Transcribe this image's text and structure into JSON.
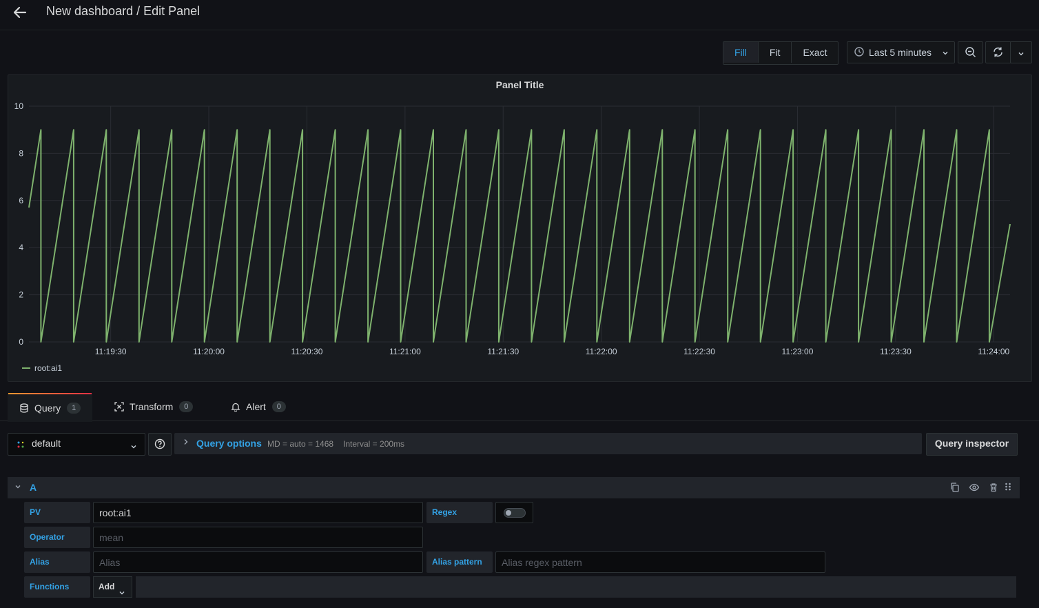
{
  "header": {
    "title": "New dashboard / Edit Panel"
  },
  "view_modes": {
    "fill": "Fill",
    "fit": "Fit",
    "exact": "Exact",
    "selected": "Fill"
  },
  "time_picker": {
    "label": "Last 5 minutes"
  },
  "panel": {
    "title": "Panel Title",
    "legend": "root:ai1"
  },
  "chart_data": {
    "type": "line",
    "title": "Panel Title",
    "xlabel": "",
    "ylabel": "",
    "ylim": [
      0,
      10
    ],
    "y_ticks": [
      "0",
      "2",
      "4",
      "6",
      "8",
      "10"
    ],
    "x_ticks": [
      "11:19:30",
      "11:20:00",
      "11:20:30",
      "11:21:00",
      "11:21:30",
      "11:22:00",
      "11:22:30",
      "11:23:00",
      "11:23:30",
      "11:24:00"
    ],
    "x_range": [
      "11:19:05",
      "11:24:05"
    ],
    "series": [
      {
        "name": "root:ai1",
        "color": "#7eb26d",
        "pattern": "sawtooth",
        "period_seconds": 10,
        "min": 0,
        "max": 9,
        "first_value": 5.7,
        "last_value": 5
      }
    ],
    "grid": true,
    "legend": "bottom-left"
  },
  "tabs": [
    {
      "label": "Query",
      "count": "1"
    },
    {
      "label": "Transform",
      "count": "0"
    },
    {
      "label": "Alert",
      "count": "0"
    }
  ],
  "query_bar": {
    "datasource": "default",
    "options_label": "Query options",
    "md_info": "MD = auto = 1468",
    "interval_info": "Interval = 200ms",
    "inspector_label": "Query inspector"
  },
  "query": {
    "ref_id": "A",
    "pv_label": "PV",
    "pv_value": "root:ai1",
    "regex_label": "Regex",
    "regex_enabled": false,
    "operator_label": "Operator",
    "operator_placeholder": "mean",
    "alias_label": "Alias",
    "alias_placeholder": "Alias",
    "alias_pattern_label": "Alias pattern",
    "alias_pattern_placeholder": "Alias regex pattern",
    "functions_label": "Functions",
    "add_label": "Add"
  },
  "colors": {
    "accent": "#33a2e5",
    "series": "#7eb26d",
    "background": "#111217",
    "panel": "#181b1f"
  }
}
